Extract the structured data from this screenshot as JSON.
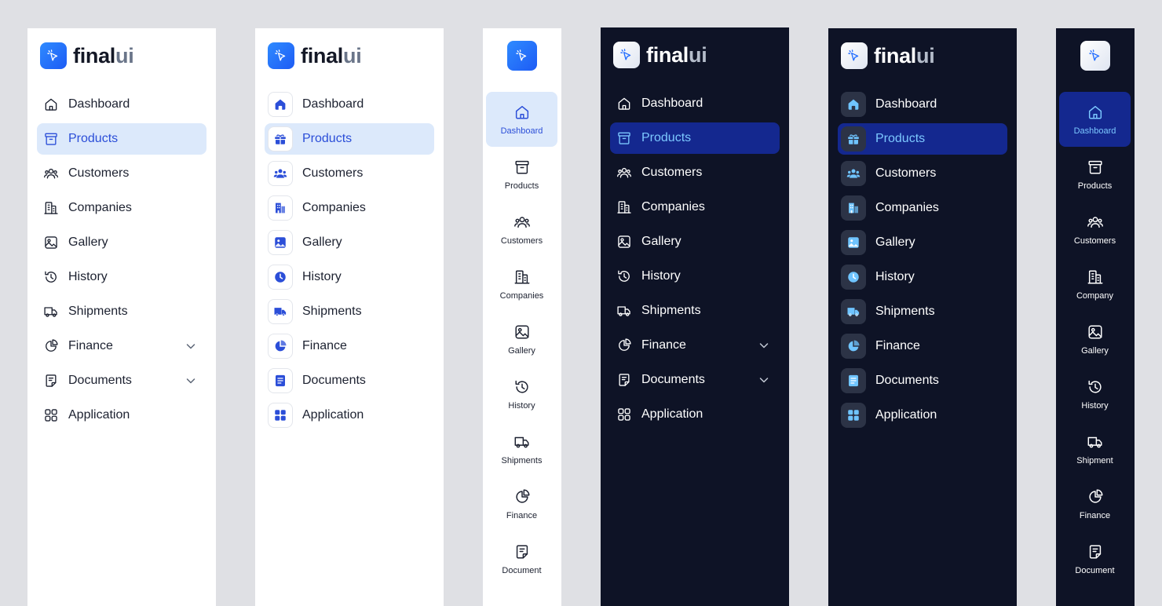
{
  "brand": {
    "name_part1": "final",
    "name_part2": "ui"
  },
  "colors": {
    "background": "#dfe0e4",
    "light_panel": "#ffffff",
    "dark_panel": "#0e1326",
    "accent": "#2b4ed8",
    "light_active_bg": "#dce9fb",
    "dark_active_bg": "#14288f",
    "dark_active_text": "#7cc8ff"
  },
  "variants": [
    {
      "theme": "light",
      "layout": "wide-outline",
      "items": [
        {
          "label": "Dashboard",
          "icon": "home-icon"
        },
        {
          "label": "Products",
          "icon": "archive-box-icon",
          "active": true
        },
        {
          "label": "Customers",
          "icon": "users-icon"
        },
        {
          "label": "Companies",
          "icon": "building-icon"
        },
        {
          "label": "Gallery",
          "icon": "image-icon"
        },
        {
          "label": "History",
          "icon": "history-icon"
        },
        {
          "label": "Shipments",
          "icon": "truck-icon"
        },
        {
          "label": "Finance",
          "icon": "pie-chart-icon",
          "expandable": true
        },
        {
          "label": "Documents",
          "icon": "document-icon",
          "expandable": true
        },
        {
          "label": "Application",
          "icon": "grid-icon"
        }
      ]
    },
    {
      "theme": "light",
      "layout": "wide-boxed",
      "items": [
        {
          "label": "Dashboard",
          "icon": "home-icon"
        },
        {
          "label": "Products",
          "icon": "gift-icon",
          "active": true
        },
        {
          "label": "Customers",
          "icon": "users-icon"
        },
        {
          "label": "Companies",
          "icon": "building-icon"
        },
        {
          "label": "Gallery",
          "icon": "image-icon"
        },
        {
          "label": "History",
          "icon": "clock-icon"
        },
        {
          "label": "Shipments",
          "icon": "truck-icon"
        },
        {
          "label": "Finance",
          "icon": "pie-chart-icon"
        },
        {
          "label": "Documents",
          "icon": "document-icon"
        },
        {
          "label": "Application",
          "icon": "grid-icon"
        }
      ]
    },
    {
      "theme": "light",
      "layout": "compact",
      "items": [
        {
          "label": "Dashboard",
          "icon": "home-icon",
          "active": true
        },
        {
          "label": "Products",
          "icon": "archive-box-icon"
        },
        {
          "label": "Customers",
          "icon": "users-icon"
        },
        {
          "label": "Companies",
          "icon": "building-icon"
        },
        {
          "label": "Gallery",
          "icon": "image-icon"
        },
        {
          "label": "History",
          "icon": "history-icon"
        },
        {
          "label": "Shipments",
          "icon": "truck-icon"
        },
        {
          "label": "Finance",
          "icon": "pie-chart-icon"
        },
        {
          "label": "Document",
          "icon": "document-icon"
        }
      ]
    },
    {
      "theme": "dark",
      "layout": "wide-outline",
      "items": [
        {
          "label": "Dashboard",
          "icon": "home-icon"
        },
        {
          "label": "Products",
          "icon": "archive-box-icon",
          "active": true
        },
        {
          "label": "Customers",
          "icon": "users-icon"
        },
        {
          "label": "Companies",
          "icon": "building-icon"
        },
        {
          "label": "Gallery",
          "icon": "image-icon"
        },
        {
          "label": "History",
          "icon": "history-icon"
        },
        {
          "label": "Shipments",
          "icon": "truck-icon"
        },
        {
          "label": "Finance",
          "icon": "pie-chart-icon",
          "expandable": true
        },
        {
          "label": "Documents",
          "icon": "document-icon",
          "expandable": true
        },
        {
          "label": "Application",
          "icon": "grid-icon"
        }
      ]
    },
    {
      "theme": "dark",
      "layout": "wide-boxed",
      "items": [
        {
          "label": "Dashboard",
          "icon": "home-icon"
        },
        {
          "label": "Products",
          "icon": "gift-icon",
          "active": true
        },
        {
          "label": "Customers",
          "icon": "users-icon"
        },
        {
          "label": "Companies",
          "icon": "building-icon"
        },
        {
          "label": "Gallery",
          "icon": "image-icon"
        },
        {
          "label": "History",
          "icon": "clock-icon"
        },
        {
          "label": "Shipments",
          "icon": "truck-icon"
        },
        {
          "label": "Finance",
          "icon": "pie-chart-icon"
        },
        {
          "label": "Documents",
          "icon": "document-icon"
        },
        {
          "label": "Application",
          "icon": "grid-icon"
        }
      ]
    },
    {
      "theme": "dark",
      "layout": "compact",
      "items": [
        {
          "label": "Dashboard",
          "icon": "home-icon",
          "active": true
        },
        {
          "label": "Products",
          "icon": "archive-box-icon"
        },
        {
          "label": "Customers",
          "icon": "users-icon"
        },
        {
          "label": "Company",
          "icon": "building-icon"
        },
        {
          "label": "Gallery",
          "icon": "image-icon"
        },
        {
          "label": "History",
          "icon": "history-icon"
        },
        {
          "label": "Shipment",
          "icon": "truck-icon"
        },
        {
          "label": "Finance",
          "icon": "pie-chart-icon"
        },
        {
          "label": "Document",
          "icon": "document-icon"
        }
      ]
    }
  ]
}
